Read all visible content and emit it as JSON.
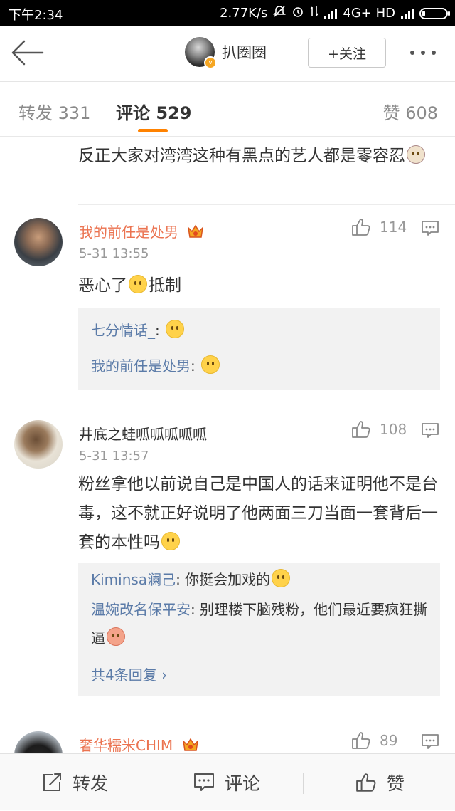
{
  "status_bar": {
    "time": "下午2:34",
    "speed": "2.77K/s",
    "network": "4G+ HD"
  },
  "header": {
    "back_icon": "back-arrow-icon",
    "username": "扒圈圈",
    "follow_label": "+关注",
    "more_icon": "more-dots-icon"
  },
  "tabs": {
    "repost": "转发 331",
    "comment": "评论 529",
    "like": "赞 608"
  },
  "feed": {
    "continued_text": "反正大家对湾湾这种有黑点的艺人都是零容忍",
    "comments": [
      {
        "name": "我的前任是处男",
        "time": "5-31 13:55",
        "likes": "114",
        "body": "恶心了",
        "body_tail": "抵制",
        "replies": [
          {
            "name": "七分情话_",
            "text": ":"
          },
          {
            "name": "我的前任是处男",
            "text": ":"
          }
        ]
      },
      {
        "name": "井底之蛙呱呱呱呱呱",
        "time": "5-31 13:57",
        "likes": "108",
        "body": "粉丝拿他以前说自己是中国人的话来证明他不是台毒，这不就正好说明了他两面三刀当面一套背后一套的本性吗",
        "replies": [
          {
            "name": "Kiminsa澜己",
            "text": ": 你挺会加戏的"
          },
          {
            "name": "温婉改名保平安",
            "text": ": 别理楼下脑残粉，他们最近要疯狂撕逼"
          }
        ],
        "more_replies": "共4条回复 ›"
      },
      {
        "name": "奢华糯米CHIM",
        "likes": "89"
      }
    ]
  },
  "bottom_bar": {
    "repost": "转发",
    "comment": "评论",
    "like": "赞"
  },
  "colors": {
    "accent": "#ff8200",
    "vip_name": "#eb7350",
    "reply_name": "#5b7ba8"
  }
}
